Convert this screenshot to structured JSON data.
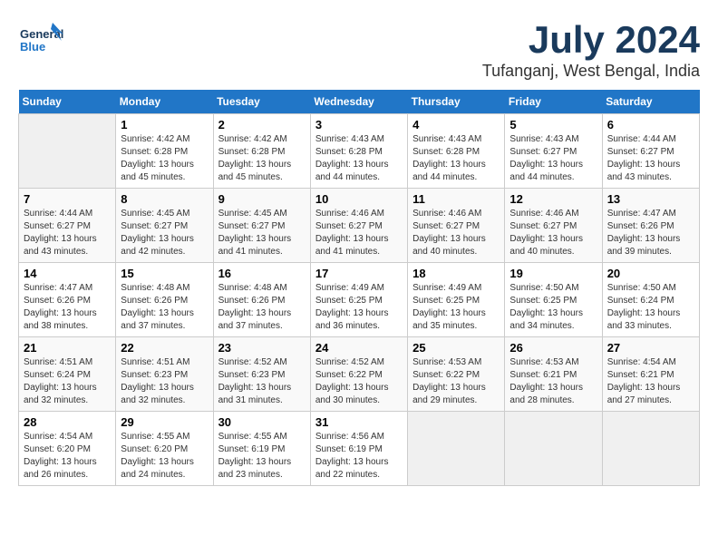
{
  "logo": {
    "line1": "General",
    "line2": "Blue"
  },
  "title": {
    "month_year": "July 2024",
    "location": "Tufanganj, West Bengal, India"
  },
  "headers": [
    "Sunday",
    "Monday",
    "Tuesday",
    "Wednesday",
    "Thursday",
    "Friday",
    "Saturday"
  ],
  "weeks": [
    [
      {
        "day": "",
        "sunrise": "",
        "sunset": "",
        "daylight": ""
      },
      {
        "day": "1",
        "sunrise": "Sunrise: 4:42 AM",
        "sunset": "Sunset: 6:28 PM",
        "daylight": "Daylight: 13 hours and 45 minutes."
      },
      {
        "day": "2",
        "sunrise": "Sunrise: 4:42 AM",
        "sunset": "Sunset: 6:28 PM",
        "daylight": "Daylight: 13 hours and 45 minutes."
      },
      {
        "day": "3",
        "sunrise": "Sunrise: 4:43 AM",
        "sunset": "Sunset: 6:28 PM",
        "daylight": "Daylight: 13 hours and 44 minutes."
      },
      {
        "day": "4",
        "sunrise": "Sunrise: 4:43 AM",
        "sunset": "Sunset: 6:28 PM",
        "daylight": "Daylight: 13 hours and 44 minutes."
      },
      {
        "day": "5",
        "sunrise": "Sunrise: 4:43 AM",
        "sunset": "Sunset: 6:27 PM",
        "daylight": "Daylight: 13 hours and 44 minutes."
      },
      {
        "day": "6",
        "sunrise": "Sunrise: 4:44 AM",
        "sunset": "Sunset: 6:27 PM",
        "daylight": "Daylight: 13 hours and 43 minutes."
      }
    ],
    [
      {
        "day": "7",
        "sunrise": "Sunrise: 4:44 AM",
        "sunset": "Sunset: 6:27 PM",
        "daylight": "Daylight: 13 hours and 43 minutes."
      },
      {
        "day": "8",
        "sunrise": "Sunrise: 4:45 AM",
        "sunset": "Sunset: 6:27 PM",
        "daylight": "Daylight: 13 hours and 42 minutes."
      },
      {
        "day": "9",
        "sunrise": "Sunrise: 4:45 AM",
        "sunset": "Sunset: 6:27 PM",
        "daylight": "Daylight: 13 hours and 41 minutes."
      },
      {
        "day": "10",
        "sunrise": "Sunrise: 4:46 AM",
        "sunset": "Sunset: 6:27 PM",
        "daylight": "Daylight: 13 hours and 41 minutes."
      },
      {
        "day": "11",
        "sunrise": "Sunrise: 4:46 AM",
        "sunset": "Sunset: 6:27 PM",
        "daylight": "Daylight: 13 hours and 40 minutes."
      },
      {
        "day": "12",
        "sunrise": "Sunrise: 4:46 AM",
        "sunset": "Sunset: 6:27 PM",
        "daylight": "Daylight: 13 hours and 40 minutes."
      },
      {
        "day": "13",
        "sunrise": "Sunrise: 4:47 AM",
        "sunset": "Sunset: 6:26 PM",
        "daylight": "Daylight: 13 hours and 39 minutes."
      }
    ],
    [
      {
        "day": "14",
        "sunrise": "Sunrise: 4:47 AM",
        "sunset": "Sunset: 6:26 PM",
        "daylight": "Daylight: 13 hours and 38 minutes."
      },
      {
        "day": "15",
        "sunrise": "Sunrise: 4:48 AM",
        "sunset": "Sunset: 6:26 PM",
        "daylight": "Daylight: 13 hours and 37 minutes."
      },
      {
        "day": "16",
        "sunrise": "Sunrise: 4:48 AM",
        "sunset": "Sunset: 6:26 PM",
        "daylight": "Daylight: 13 hours and 37 minutes."
      },
      {
        "day": "17",
        "sunrise": "Sunrise: 4:49 AM",
        "sunset": "Sunset: 6:25 PM",
        "daylight": "Daylight: 13 hours and 36 minutes."
      },
      {
        "day": "18",
        "sunrise": "Sunrise: 4:49 AM",
        "sunset": "Sunset: 6:25 PM",
        "daylight": "Daylight: 13 hours and 35 minutes."
      },
      {
        "day": "19",
        "sunrise": "Sunrise: 4:50 AM",
        "sunset": "Sunset: 6:25 PM",
        "daylight": "Daylight: 13 hours and 34 minutes."
      },
      {
        "day": "20",
        "sunrise": "Sunrise: 4:50 AM",
        "sunset": "Sunset: 6:24 PM",
        "daylight": "Daylight: 13 hours and 33 minutes."
      }
    ],
    [
      {
        "day": "21",
        "sunrise": "Sunrise: 4:51 AM",
        "sunset": "Sunset: 6:24 PM",
        "daylight": "Daylight: 13 hours and 32 minutes."
      },
      {
        "day": "22",
        "sunrise": "Sunrise: 4:51 AM",
        "sunset": "Sunset: 6:23 PM",
        "daylight": "Daylight: 13 hours and 32 minutes."
      },
      {
        "day": "23",
        "sunrise": "Sunrise: 4:52 AM",
        "sunset": "Sunset: 6:23 PM",
        "daylight": "Daylight: 13 hours and 31 minutes."
      },
      {
        "day": "24",
        "sunrise": "Sunrise: 4:52 AM",
        "sunset": "Sunset: 6:22 PM",
        "daylight": "Daylight: 13 hours and 30 minutes."
      },
      {
        "day": "25",
        "sunrise": "Sunrise: 4:53 AM",
        "sunset": "Sunset: 6:22 PM",
        "daylight": "Daylight: 13 hours and 29 minutes."
      },
      {
        "day": "26",
        "sunrise": "Sunrise: 4:53 AM",
        "sunset": "Sunset: 6:21 PM",
        "daylight": "Daylight: 13 hours and 28 minutes."
      },
      {
        "day": "27",
        "sunrise": "Sunrise: 4:54 AM",
        "sunset": "Sunset: 6:21 PM",
        "daylight": "Daylight: 13 hours and 27 minutes."
      }
    ],
    [
      {
        "day": "28",
        "sunrise": "Sunrise: 4:54 AM",
        "sunset": "Sunset: 6:20 PM",
        "daylight": "Daylight: 13 hours and 26 minutes."
      },
      {
        "day": "29",
        "sunrise": "Sunrise: 4:55 AM",
        "sunset": "Sunset: 6:20 PM",
        "daylight": "Daylight: 13 hours and 24 minutes."
      },
      {
        "day": "30",
        "sunrise": "Sunrise: 4:55 AM",
        "sunset": "Sunset: 6:19 PM",
        "daylight": "Daylight: 13 hours and 23 minutes."
      },
      {
        "day": "31",
        "sunrise": "Sunrise: 4:56 AM",
        "sunset": "Sunset: 6:19 PM",
        "daylight": "Daylight: 13 hours and 22 minutes."
      },
      {
        "day": "",
        "sunrise": "",
        "sunset": "",
        "daylight": ""
      },
      {
        "day": "",
        "sunrise": "",
        "sunset": "",
        "daylight": ""
      },
      {
        "day": "",
        "sunrise": "",
        "sunset": "",
        "daylight": ""
      }
    ]
  ]
}
